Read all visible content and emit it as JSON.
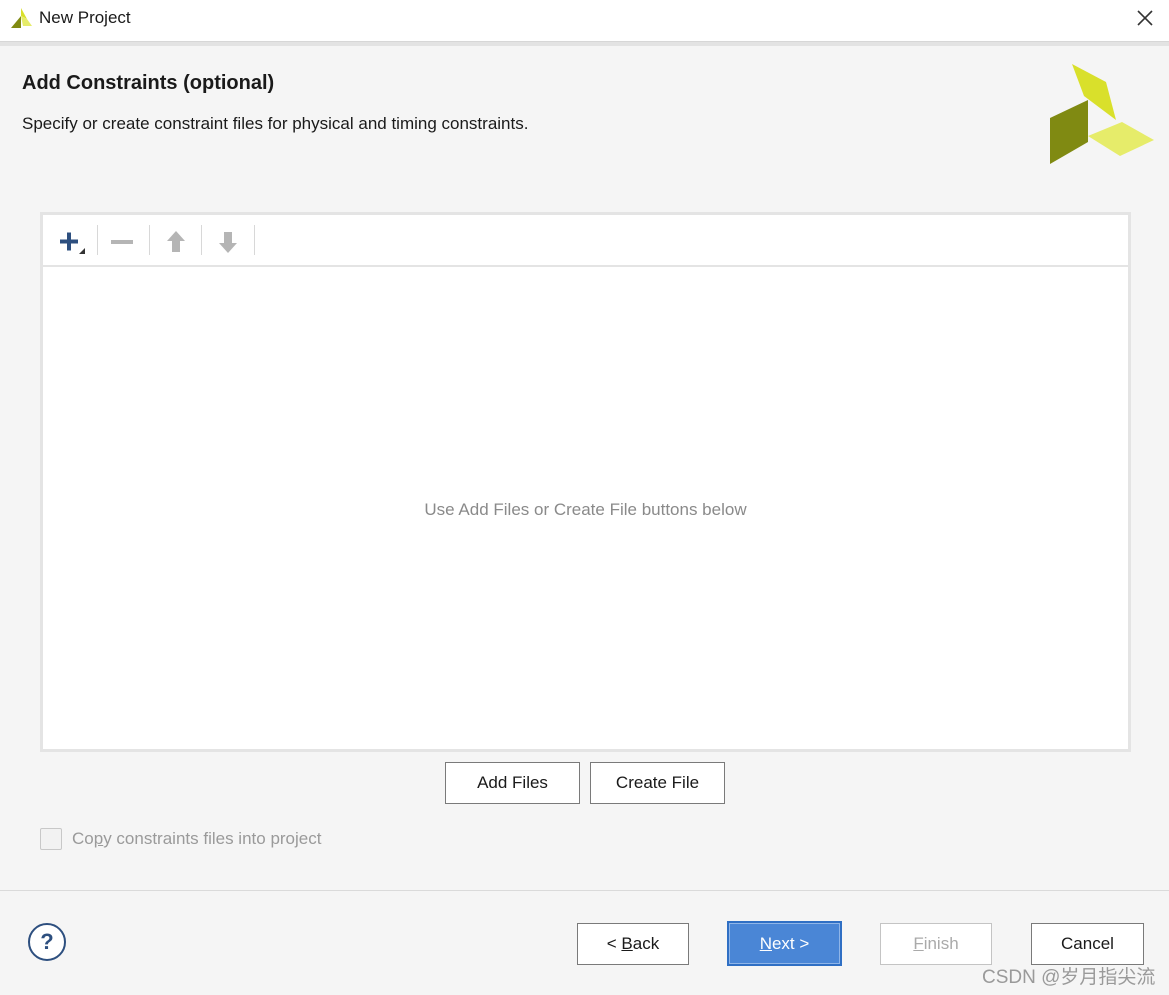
{
  "window": {
    "title": "New Project",
    "app_icon": "vivado-logo-icon",
    "close_icon": "close-icon"
  },
  "page": {
    "heading": "Add Constraints (optional)",
    "subheading": "Specify or create constraint files for physical and timing constraints."
  },
  "toolbar": {
    "items": [
      {
        "icon": "add-icon",
        "enabled": true
      },
      {
        "icon": "remove-icon",
        "enabled": false
      },
      {
        "icon": "move-up-icon",
        "enabled": false
      },
      {
        "icon": "move-down-icon",
        "enabled": false
      }
    ]
  },
  "file_list": {
    "empty_message": "Use Add Files or Create File buttons below"
  },
  "actions": {
    "add_files": "Add Files",
    "create_file": "Create File"
  },
  "copy_option": {
    "label_prefix": "Co",
    "label_mnemonic": "p",
    "label_suffix": "y constraints files into project",
    "checked": false,
    "enabled": false
  },
  "footer": {
    "help": "?",
    "back_prefix": "< ",
    "back_mnemonic": "B",
    "back_suffix": "ack",
    "next_mnemonic": "N",
    "next_suffix": "ext >",
    "finish_mnemonic": "F",
    "finish_suffix": "inish",
    "cancel": "Cancel"
  },
  "watermark": "CSDN @岁月指尖流",
  "colors": {
    "primary_button": "#4a86d6",
    "logo_light": "#d9e02b",
    "logo_dark": "#808a12",
    "icon_blue": "#2d4f7f"
  }
}
